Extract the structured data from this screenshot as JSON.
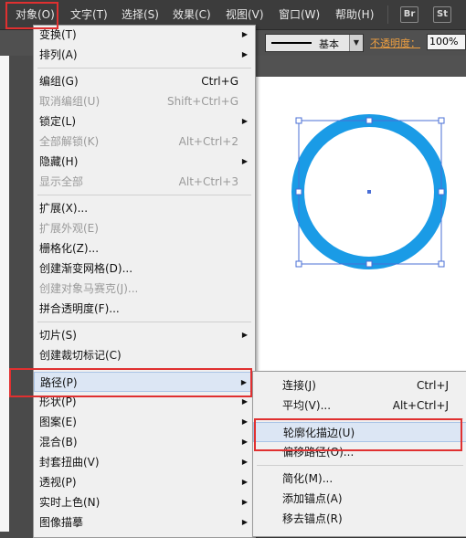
{
  "menubar": {
    "items": [
      {
        "label": "对象(O)",
        "active": true
      },
      {
        "label": "文字(T)"
      },
      {
        "label": "选择(S)"
      },
      {
        "label": "效果(C)"
      },
      {
        "label": "视图(V)"
      },
      {
        "label": "窗口(W)"
      },
      {
        "label": "帮助(H)"
      }
    ],
    "icons": [
      {
        "name": "bridge-icon",
        "text": "Br"
      },
      {
        "name": "stock-icon",
        "text": "St"
      }
    ]
  },
  "controlbar": {
    "stroke_style": "基本",
    "opacity_label": "不透明度：",
    "opacity_value": "100%"
  },
  "object_menu": {
    "items": [
      {
        "label": "变换(T)",
        "submenu": true
      },
      {
        "label": "排列(A)",
        "submenu": true
      },
      {
        "sep": true
      },
      {
        "label": "编组(G)",
        "shortcut": "Ctrl+G"
      },
      {
        "label": "取消编组(U)",
        "shortcut": "Shift+Ctrl+G",
        "disabled": true
      },
      {
        "label": "锁定(L)",
        "submenu": true
      },
      {
        "label": "全部解锁(K)",
        "shortcut": "Alt+Ctrl+2",
        "disabled": true
      },
      {
        "label": "隐藏(H)",
        "submenu": true
      },
      {
        "label": "显示全部",
        "shortcut": "Alt+Ctrl+3",
        "disabled": true
      },
      {
        "sep": true
      },
      {
        "label": "扩展(X)..."
      },
      {
        "label": "扩展外观(E)",
        "disabled": true
      },
      {
        "label": "栅格化(Z)..."
      },
      {
        "label": "创建渐变网格(D)..."
      },
      {
        "label": "创建对象马赛克(J)...",
        "disabled": true
      },
      {
        "label": "拼合透明度(F)..."
      },
      {
        "sep": true
      },
      {
        "label": "切片(S)",
        "submenu": true
      },
      {
        "label": "创建裁切标记(C)"
      },
      {
        "sep": true
      },
      {
        "label": "路径(P)",
        "submenu": true,
        "highlight": true
      },
      {
        "label": "形状(P)",
        "submenu": true
      },
      {
        "label": "图案(E)",
        "submenu": true
      },
      {
        "label": "混合(B)",
        "submenu": true
      },
      {
        "label": "封套扭曲(V)",
        "submenu": true
      },
      {
        "label": "透视(P)",
        "submenu": true
      },
      {
        "label": "实时上色(N)",
        "submenu": true
      },
      {
        "label": "图像描摹",
        "submenu": true
      }
    ]
  },
  "path_submenu": {
    "items": [
      {
        "label": "连接(J)",
        "shortcut": "Ctrl+J"
      },
      {
        "label": "平均(V)...",
        "shortcut": "Alt+Ctrl+J"
      },
      {
        "sep": true
      },
      {
        "label": "轮廓化描边(U)",
        "highlight": true
      },
      {
        "label": "偏移路径(O)..."
      },
      {
        "sep": true
      },
      {
        "label": "简化(M)..."
      },
      {
        "label": "添加锚点(A)"
      },
      {
        "label": "移去锚点(R)"
      }
    ]
  },
  "canvas": {
    "circle_color": "#1a9be6",
    "selection_color": "#4a6fd6"
  },
  "colors": {
    "menubar_bg": "#3c3c3c",
    "annotation_red": "#e03030",
    "menu_bg": "#f0f0f0"
  }
}
